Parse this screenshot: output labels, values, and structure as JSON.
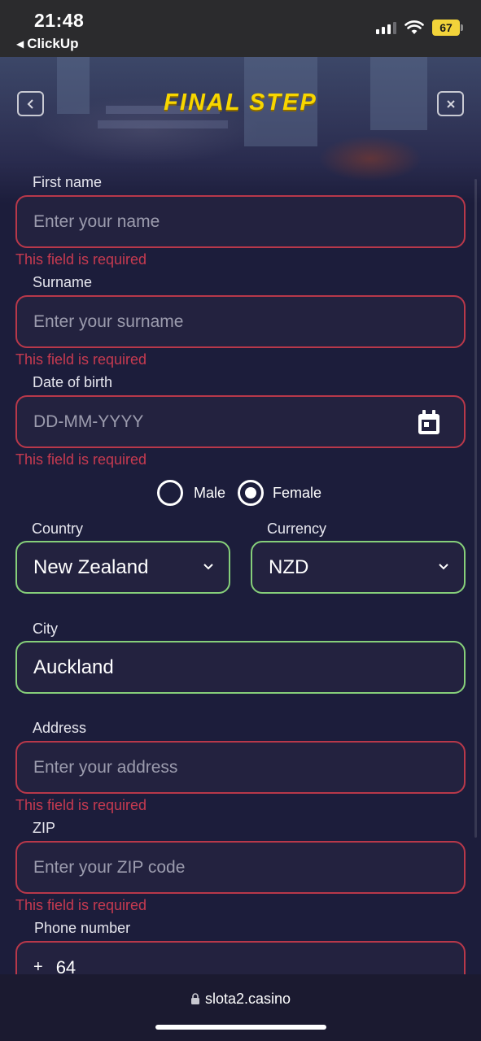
{
  "status_bar": {
    "time": "21:48",
    "back_app": "ClickUp",
    "battery": "67"
  },
  "header": {
    "title": "FINAL STEP",
    "back_icon": "chevron-left-icon",
    "close_icon": "close-icon"
  },
  "form": {
    "first_name": {
      "label": "First name",
      "placeholder": "Enter your name",
      "error": "This field is required"
    },
    "surname": {
      "label": "Surname",
      "placeholder": "Enter your surname",
      "error": "This field is required"
    },
    "dob": {
      "label": "Date of birth",
      "placeholder": "DD-MM-YYYY",
      "error": "This field is required"
    },
    "gender": {
      "options": [
        "Male",
        "Female"
      ],
      "selected": "Female"
    },
    "country": {
      "label": "Country",
      "value": "New Zealand"
    },
    "currency": {
      "label": "Currency",
      "value": "NZD"
    },
    "city": {
      "label": "City",
      "value": "Auckland"
    },
    "address": {
      "label": "Address",
      "placeholder": "Enter your address",
      "error": "This field is required"
    },
    "zip": {
      "label": "ZIP",
      "placeholder": "Enter your ZIP code",
      "error": "This field is required"
    },
    "phone": {
      "label": "Phone number",
      "plus": "+",
      "code": "64"
    }
  },
  "browser": {
    "url": "slota2.casino"
  },
  "colors": {
    "accent_title": "#f7d600",
    "error": "#c73a50",
    "valid": "#86cf7a",
    "background": "#1c1d3b"
  }
}
